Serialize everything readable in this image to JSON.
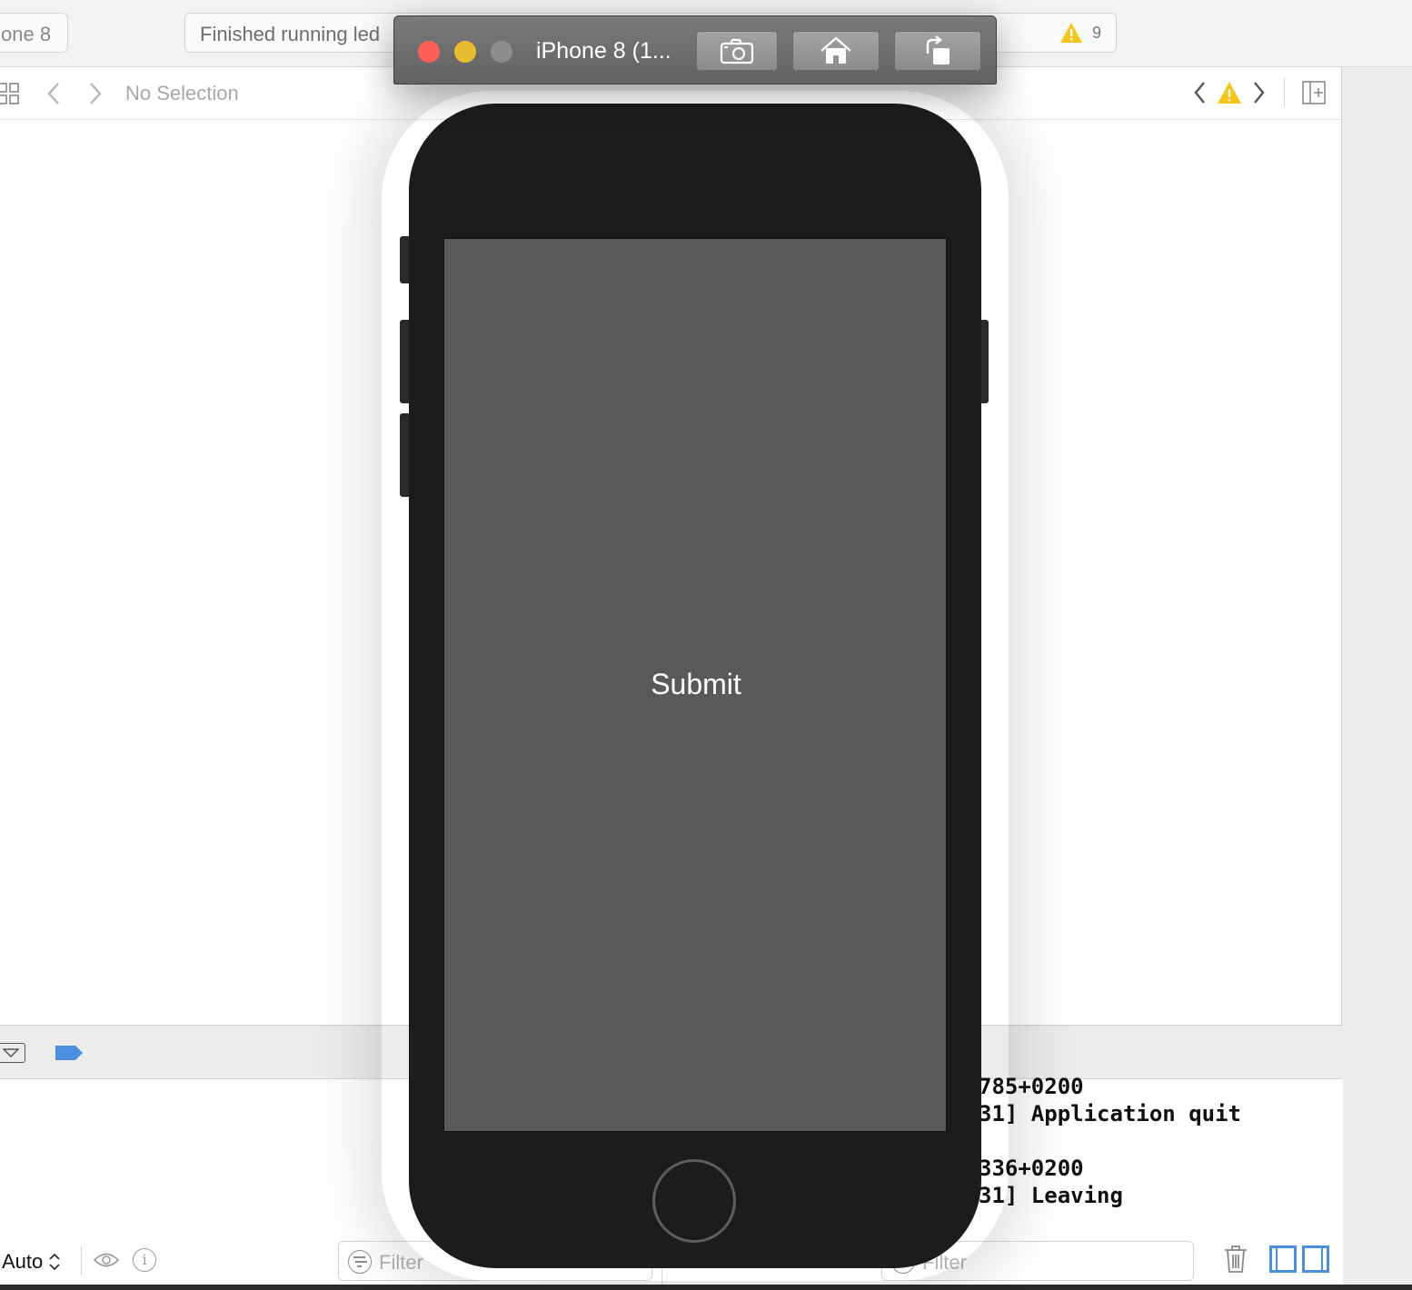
{
  "toolbar": {
    "scheme_text": "one 8",
    "activity_text": "Finished running led",
    "warning_count": "9"
  },
  "jumpbar": {
    "text": "No Selection"
  },
  "simulator": {
    "title": "iPhone 8 (1...",
    "screen_button_label": "Submit",
    "colors": {
      "screen": "#595959",
      "bezel": "#1c1c1c",
      "close": "#fe5f57",
      "minimize": "#e8bd2f",
      "zoom": "#8e8e8e"
    }
  },
  "console": {
    "lines": [
      "785+0200",
      "31] Application quit",
      "336+0200",
      "31] Leaving"
    ]
  },
  "bottombar": {
    "auto_label": "Auto",
    "filter_placeholder": "Filter",
    "filter_right_placeholder": "Filter"
  },
  "icons": [
    "grid-icon",
    "chevron-left-icon",
    "chevron-right-icon",
    "warning-icon",
    "add-editor-icon",
    "camera-icon",
    "home-icon",
    "rotate-icon",
    "eye-icon",
    "info-icon",
    "filter-icon",
    "trash-icon",
    "breakpoint-tag-icon"
  ]
}
